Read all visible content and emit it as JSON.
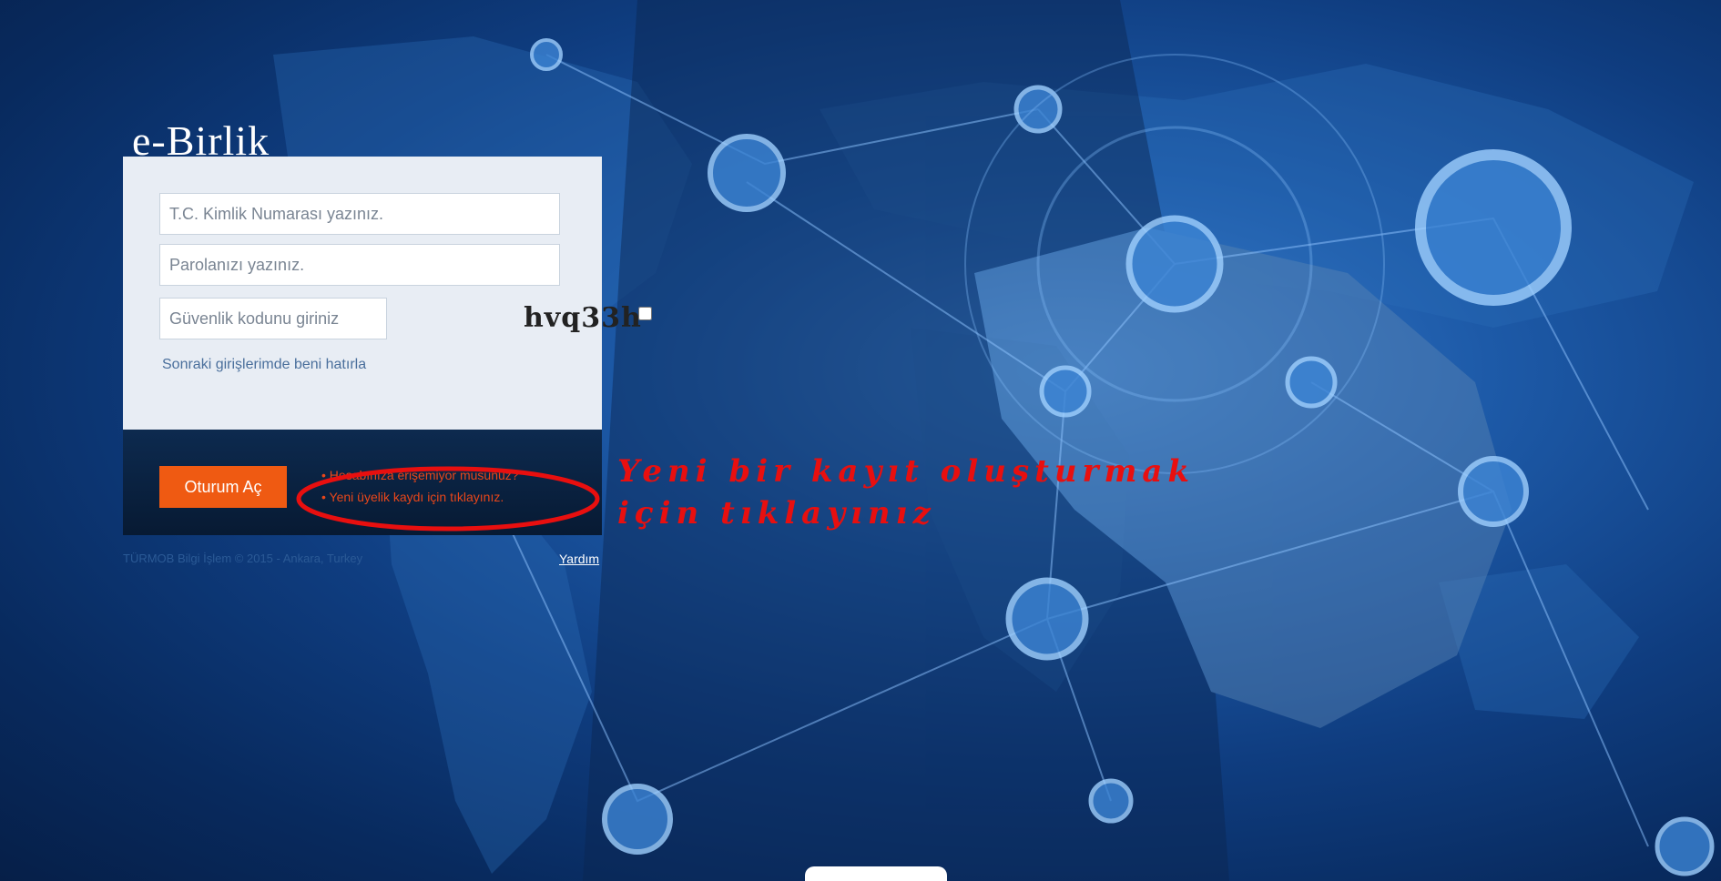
{
  "app": {
    "brand": "e-Birlik"
  },
  "login": {
    "tc_placeholder": "T.C. Kimlik Numarası yazınız.",
    "password_placeholder": "Parolanızı yazınız.",
    "captcha_placeholder": "Güvenlik kodunu giriniz",
    "captcha_code": "hvq33h",
    "remember_label": "Sonraki girişlerimde beni hatırla",
    "submit_label": "Oturum Aç"
  },
  "links": {
    "forgot_account": "• Hesabınıza erişemiyor musunuz?",
    "new_registration": "• Yeni üyelik kaydı için tıklayınız."
  },
  "footer": {
    "copyright": "TÜRMOB Bilgi İşlem © 2015 - Ankara, Turkey",
    "help": "Yardım"
  },
  "annotation": {
    "line1": "Yeni bir kayıt oluşturmak",
    "line2": "için tıklayınız"
  },
  "colors": {
    "accent": "#ef5a12",
    "annotation_red": "#e80f0f",
    "background_blue": "#0f3d80"
  }
}
